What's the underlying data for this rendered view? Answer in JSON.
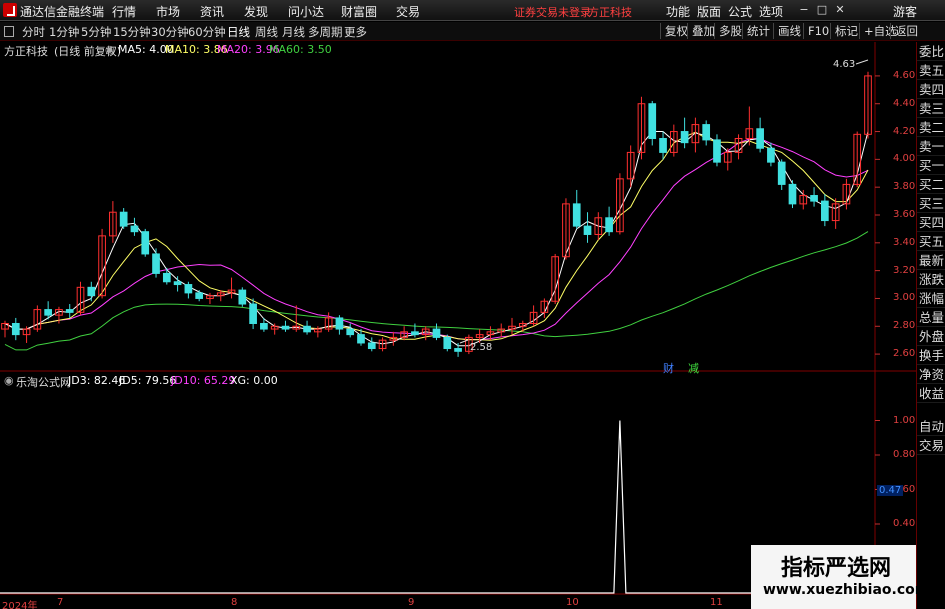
{
  "menubar": {
    "app_title": "通达信金融终端",
    "menus": [
      "行情",
      "市场",
      "资讯",
      "发现",
      "问小达",
      "财富圈",
      "交易"
    ],
    "warning": "证券交易未登录",
    "broker": "方正科技",
    "right": [
      "功能",
      "版面",
      "公式",
      "选项"
    ],
    "guest": "游客"
  },
  "toolbar": {
    "periods": [
      "分时",
      "1分钟",
      "5分钟",
      "15分钟",
      "30分钟",
      "60分钟",
      "日线",
      "周线",
      "月线",
      "多周期",
      "更多"
    ],
    "active_period": "日线",
    "right_buttons": [
      "复权",
      "叠加",
      "多股",
      "统计",
      "画线",
      "F10",
      "标记",
      "+自选",
      "返回"
    ]
  },
  "main_header": {
    "stock": "方正科技",
    "mode": "(日线 前复权)",
    "ma": [
      {
        "label": "MA5: 4.00",
        "color": "#ffffff"
      },
      {
        "label": "MA10: 3.86",
        "color": "#ffff66"
      },
      {
        "label": "MA20: 3.96",
        "color": "#ff40ff"
      },
      {
        "label": "MA60: 3.50",
        "color": "#40d040"
      }
    ]
  },
  "indicator_header": {
    "name": "乐淘公式网",
    "items": [
      {
        "label": "JD3: 82.46",
        "color": "#ffffff"
      },
      {
        "label": "JD5: 79.56",
        "color": "#ffffff"
      },
      {
        "label": "JD10: 65.29",
        "color": "#ff40ff"
      },
      {
        "label": "XG: 0.00",
        "color": "#ffffff"
      }
    ]
  },
  "right_panel": {
    "items": [
      "委比",
      "卖五",
      "卖四",
      "卖三",
      "卖二",
      "卖一",
      "买一",
      "买二",
      "买三",
      "买四",
      "买五",
      "最新",
      "涨跌",
      "涨幅",
      "总量",
      "外盘",
      "换手",
      "净资",
      "收益",
      "自动",
      "交易"
    ]
  },
  "price_axis": [
    "4.60",
    "4.40",
    "4.20",
    "4.00",
    "3.80",
    "3.60",
    "3.40",
    "3.20",
    "3.00",
    "2.80",
    "2.60"
  ],
  "indicator_axis": [
    "1.00",
    "0.80",
    "0.60",
    "0.40"
  ],
  "indicator_cursor": "0.47",
  "date_axis": [
    "2024年",
    "7",
    "8",
    "9",
    "10",
    "11"
  ],
  "annotations": {
    "high": "4.63",
    "low": "2.58",
    "cai": "财",
    "jian": "减"
  },
  "watermark": {
    "cn": "指标严选网",
    "url": "www.xuezhibiao.com"
  },
  "colors": {
    "up": "#ff3030",
    "down": "#40e0e0",
    "axis": "#e04040"
  },
  "chart_data": {
    "type": "candlestick",
    "ylim": [
      2.5,
      4.7
    ],
    "candles": [
      [
        2.78,
        2.84,
        2.72,
        2.82
      ],
      [
        2.82,
        2.86,
        2.7,
        2.74
      ],
      [
        2.74,
        2.8,
        2.68,
        2.78
      ],
      [
        2.78,
        2.95,
        2.76,
        2.92
      ],
      [
        2.92,
        2.98,
        2.85,
        2.88
      ],
      [
        2.88,
        2.94,
        2.82,
        2.92
      ],
      [
        2.92,
        2.96,
        2.86,
        2.9
      ],
      [
        2.9,
        3.12,
        2.88,
        3.08
      ],
      [
        3.08,
        3.12,
        2.98,
        3.02
      ],
      [
        3.02,
        3.5,
        3.0,
        3.45
      ],
      [
        3.45,
        3.7,
        3.4,
        3.62
      ],
      [
        3.62,
        3.65,
        3.5,
        3.52
      ],
      [
        3.52,
        3.58,
        3.45,
        3.48
      ],
      [
        3.48,
        3.5,
        3.3,
        3.32
      ],
      [
        3.32,
        3.36,
        3.15,
        3.18
      ],
      [
        3.18,
        3.22,
        3.1,
        3.12
      ],
      [
        3.12,
        3.16,
        3.05,
        3.1
      ],
      [
        3.1,
        3.12,
        3.0,
        3.04
      ],
      [
        3.04,
        3.06,
        2.98,
        3.0
      ],
      [
        3.0,
        3.04,
        2.96,
        3.02
      ],
      [
        3.02,
        3.06,
        2.98,
        3.04
      ],
      [
        3.04,
        3.15,
        3.0,
        3.06
      ],
      [
        3.06,
        3.08,
        2.94,
        2.96
      ],
      [
        2.96,
        3.0,
        2.78,
        2.82
      ],
      [
        2.82,
        2.86,
        2.76,
        2.78
      ],
      [
        2.78,
        2.82,
        2.74,
        2.8
      ],
      [
        2.8,
        2.84,
        2.76,
        2.78
      ],
      [
        2.78,
        2.95,
        2.76,
        2.8
      ],
      [
        2.8,
        2.84,
        2.74,
        2.76
      ],
      [
        2.76,
        2.8,
        2.72,
        2.78
      ],
      [
        2.78,
        2.9,
        2.76,
        2.86
      ],
      [
        2.86,
        2.88,
        2.74,
        2.78
      ],
      [
        2.78,
        2.82,
        2.72,
        2.74
      ],
      [
        2.74,
        2.78,
        2.66,
        2.68
      ],
      [
        2.68,
        2.72,
        2.62,
        2.64
      ],
      [
        2.64,
        2.72,
        2.62,
        2.7
      ],
      [
        2.7,
        2.76,
        2.66,
        2.72
      ],
      [
        2.72,
        2.8,
        2.7,
        2.76
      ],
      [
        2.76,
        2.82,
        2.72,
        2.74
      ],
      [
        2.74,
        2.8,
        2.7,
        2.78
      ],
      [
        2.78,
        2.82,
        2.7,
        2.72
      ],
      [
        2.72,
        2.74,
        2.62,
        2.64
      ],
      [
        2.64,
        2.68,
        2.58,
        2.62
      ],
      [
        2.62,
        2.74,
        2.6,
        2.72
      ],
      [
        2.72,
        2.78,
        2.68,
        2.74
      ],
      [
        2.74,
        2.8,
        2.7,
        2.76
      ],
      [
        2.76,
        2.82,
        2.72,
        2.78
      ],
      [
        2.78,
        2.86,
        2.74,
        2.8
      ],
      [
        2.8,
        2.84,
        2.76,
        2.82
      ],
      [
        2.82,
        2.95,
        2.8,
        2.9
      ],
      [
        2.9,
        3.0,
        2.86,
        2.98
      ],
      [
        2.98,
        3.32,
        2.96,
        3.3
      ],
      [
        3.3,
        3.72,
        3.28,
        3.68
      ],
      [
        3.68,
        3.78,
        3.5,
        3.52
      ],
      [
        3.52,
        3.62,
        3.4,
        3.46
      ],
      [
        3.46,
        3.62,
        3.42,
        3.58
      ],
      [
        3.58,
        3.66,
        3.45,
        3.48
      ],
      [
        3.48,
        3.9,
        3.46,
        3.86
      ],
      [
        3.86,
        4.1,
        3.8,
        4.05
      ],
      [
        4.05,
        4.45,
        4.0,
        4.4
      ],
      [
        4.4,
        4.42,
        4.1,
        4.15
      ],
      [
        4.15,
        4.2,
        4.0,
        4.05
      ],
      [
        4.05,
        4.25,
        4.02,
        4.2
      ],
      [
        4.2,
        4.3,
        4.08,
        4.12
      ],
      [
        4.12,
        4.3,
        4.05,
        4.25
      ],
      [
        4.25,
        4.28,
        4.1,
        4.14
      ],
      [
        4.14,
        4.18,
        3.95,
        3.98
      ],
      [
        3.98,
        4.08,
        3.92,
        4.05
      ],
      [
        4.05,
        4.18,
        4.0,
        4.15
      ],
      [
        4.15,
        4.38,
        4.1,
        4.22
      ],
      [
        4.22,
        4.3,
        4.05,
        4.08
      ],
      [
        4.08,
        4.12,
        3.95,
        3.98
      ],
      [
        3.98,
        4.0,
        3.78,
        3.82
      ],
      [
        3.82,
        3.85,
        3.65,
        3.68
      ],
      [
        3.68,
        3.78,
        3.64,
        3.74
      ],
      [
        3.74,
        3.8,
        3.66,
        3.7
      ],
      [
        3.7,
        3.75,
        3.52,
        3.56
      ],
      [
        3.56,
        3.72,
        3.5,
        3.68
      ],
      [
        3.68,
        3.86,
        3.64,
        3.82
      ],
      [
        3.82,
        4.2,
        3.8,
        4.18
      ],
      [
        4.18,
        4.63,
        4.15,
        4.6
      ]
    ],
    "indicator": {
      "ylim": [
        0,
        1.2
      ],
      "spike_index": 57,
      "spike_value": 1.0
    }
  }
}
